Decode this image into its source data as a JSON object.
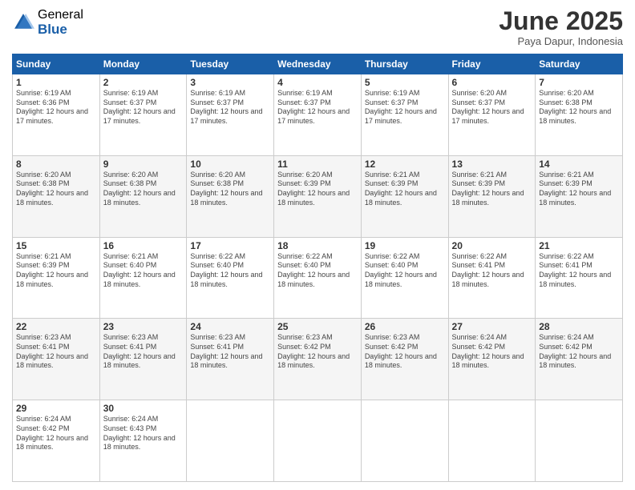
{
  "logo": {
    "general": "General",
    "blue": "Blue"
  },
  "header": {
    "month": "June 2025",
    "location": "Paya Dapur, Indonesia"
  },
  "weekdays": [
    "Sunday",
    "Monday",
    "Tuesday",
    "Wednesday",
    "Thursday",
    "Friday",
    "Saturday"
  ],
  "weeks": [
    [
      {
        "day": "1",
        "sunrise": "6:19 AM",
        "sunset": "6:36 PM",
        "daylight": "12 hours and 17 minutes"
      },
      {
        "day": "2",
        "sunrise": "6:19 AM",
        "sunset": "6:37 PM",
        "daylight": "12 hours and 17 minutes"
      },
      {
        "day": "3",
        "sunrise": "6:19 AM",
        "sunset": "6:37 PM",
        "daylight": "12 hours and 17 minutes"
      },
      {
        "day": "4",
        "sunrise": "6:19 AM",
        "sunset": "6:37 PM",
        "daylight": "12 hours and 17 minutes"
      },
      {
        "day": "5",
        "sunrise": "6:19 AM",
        "sunset": "6:37 PM",
        "daylight": "12 hours and 17 minutes"
      },
      {
        "day": "6",
        "sunrise": "6:20 AM",
        "sunset": "6:37 PM",
        "daylight": "12 hours and 17 minutes"
      },
      {
        "day": "7",
        "sunrise": "6:20 AM",
        "sunset": "6:38 PM",
        "daylight": "12 hours and 18 minutes"
      }
    ],
    [
      {
        "day": "8",
        "sunrise": "6:20 AM",
        "sunset": "6:38 PM",
        "daylight": "12 hours and 18 minutes"
      },
      {
        "day": "9",
        "sunrise": "6:20 AM",
        "sunset": "6:38 PM",
        "daylight": "12 hours and 18 minutes"
      },
      {
        "day": "10",
        "sunrise": "6:20 AM",
        "sunset": "6:38 PM",
        "daylight": "12 hours and 18 minutes"
      },
      {
        "day": "11",
        "sunrise": "6:20 AM",
        "sunset": "6:39 PM",
        "daylight": "12 hours and 18 minutes"
      },
      {
        "day": "12",
        "sunrise": "6:21 AM",
        "sunset": "6:39 PM",
        "daylight": "12 hours and 18 minutes"
      },
      {
        "day": "13",
        "sunrise": "6:21 AM",
        "sunset": "6:39 PM",
        "daylight": "12 hours and 18 minutes"
      },
      {
        "day": "14",
        "sunrise": "6:21 AM",
        "sunset": "6:39 PM",
        "daylight": "12 hours and 18 minutes"
      }
    ],
    [
      {
        "day": "15",
        "sunrise": "6:21 AM",
        "sunset": "6:39 PM",
        "daylight": "12 hours and 18 minutes"
      },
      {
        "day": "16",
        "sunrise": "6:21 AM",
        "sunset": "6:40 PM",
        "daylight": "12 hours and 18 minutes"
      },
      {
        "day": "17",
        "sunrise": "6:22 AM",
        "sunset": "6:40 PM",
        "daylight": "12 hours and 18 minutes"
      },
      {
        "day": "18",
        "sunrise": "6:22 AM",
        "sunset": "6:40 PM",
        "daylight": "12 hours and 18 minutes"
      },
      {
        "day": "19",
        "sunrise": "6:22 AM",
        "sunset": "6:40 PM",
        "daylight": "12 hours and 18 minutes"
      },
      {
        "day": "20",
        "sunrise": "6:22 AM",
        "sunset": "6:41 PM",
        "daylight": "12 hours and 18 minutes"
      },
      {
        "day": "21",
        "sunrise": "6:22 AM",
        "sunset": "6:41 PM",
        "daylight": "12 hours and 18 minutes"
      }
    ],
    [
      {
        "day": "22",
        "sunrise": "6:23 AM",
        "sunset": "6:41 PM",
        "daylight": "12 hours and 18 minutes"
      },
      {
        "day": "23",
        "sunrise": "6:23 AM",
        "sunset": "6:41 PM",
        "daylight": "12 hours and 18 minutes"
      },
      {
        "day": "24",
        "sunrise": "6:23 AM",
        "sunset": "6:41 PM",
        "daylight": "12 hours and 18 minutes"
      },
      {
        "day": "25",
        "sunrise": "6:23 AM",
        "sunset": "6:42 PM",
        "daylight": "12 hours and 18 minutes"
      },
      {
        "day": "26",
        "sunrise": "6:23 AM",
        "sunset": "6:42 PM",
        "daylight": "12 hours and 18 minutes"
      },
      {
        "day": "27",
        "sunrise": "6:24 AM",
        "sunset": "6:42 PM",
        "daylight": "12 hours and 18 minutes"
      },
      {
        "day": "28",
        "sunrise": "6:24 AM",
        "sunset": "6:42 PM",
        "daylight": "12 hours and 18 minutes"
      }
    ],
    [
      {
        "day": "29",
        "sunrise": "6:24 AM",
        "sunset": "6:42 PM",
        "daylight": "12 hours and 18 minutes"
      },
      {
        "day": "30",
        "sunrise": "6:24 AM",
        "sunset": "6:43 PM",
        "daylight": "12 hours and 18 minutes"
      },
      null,
      null,
      null,
      null,
      null
    ]
  ]
}
